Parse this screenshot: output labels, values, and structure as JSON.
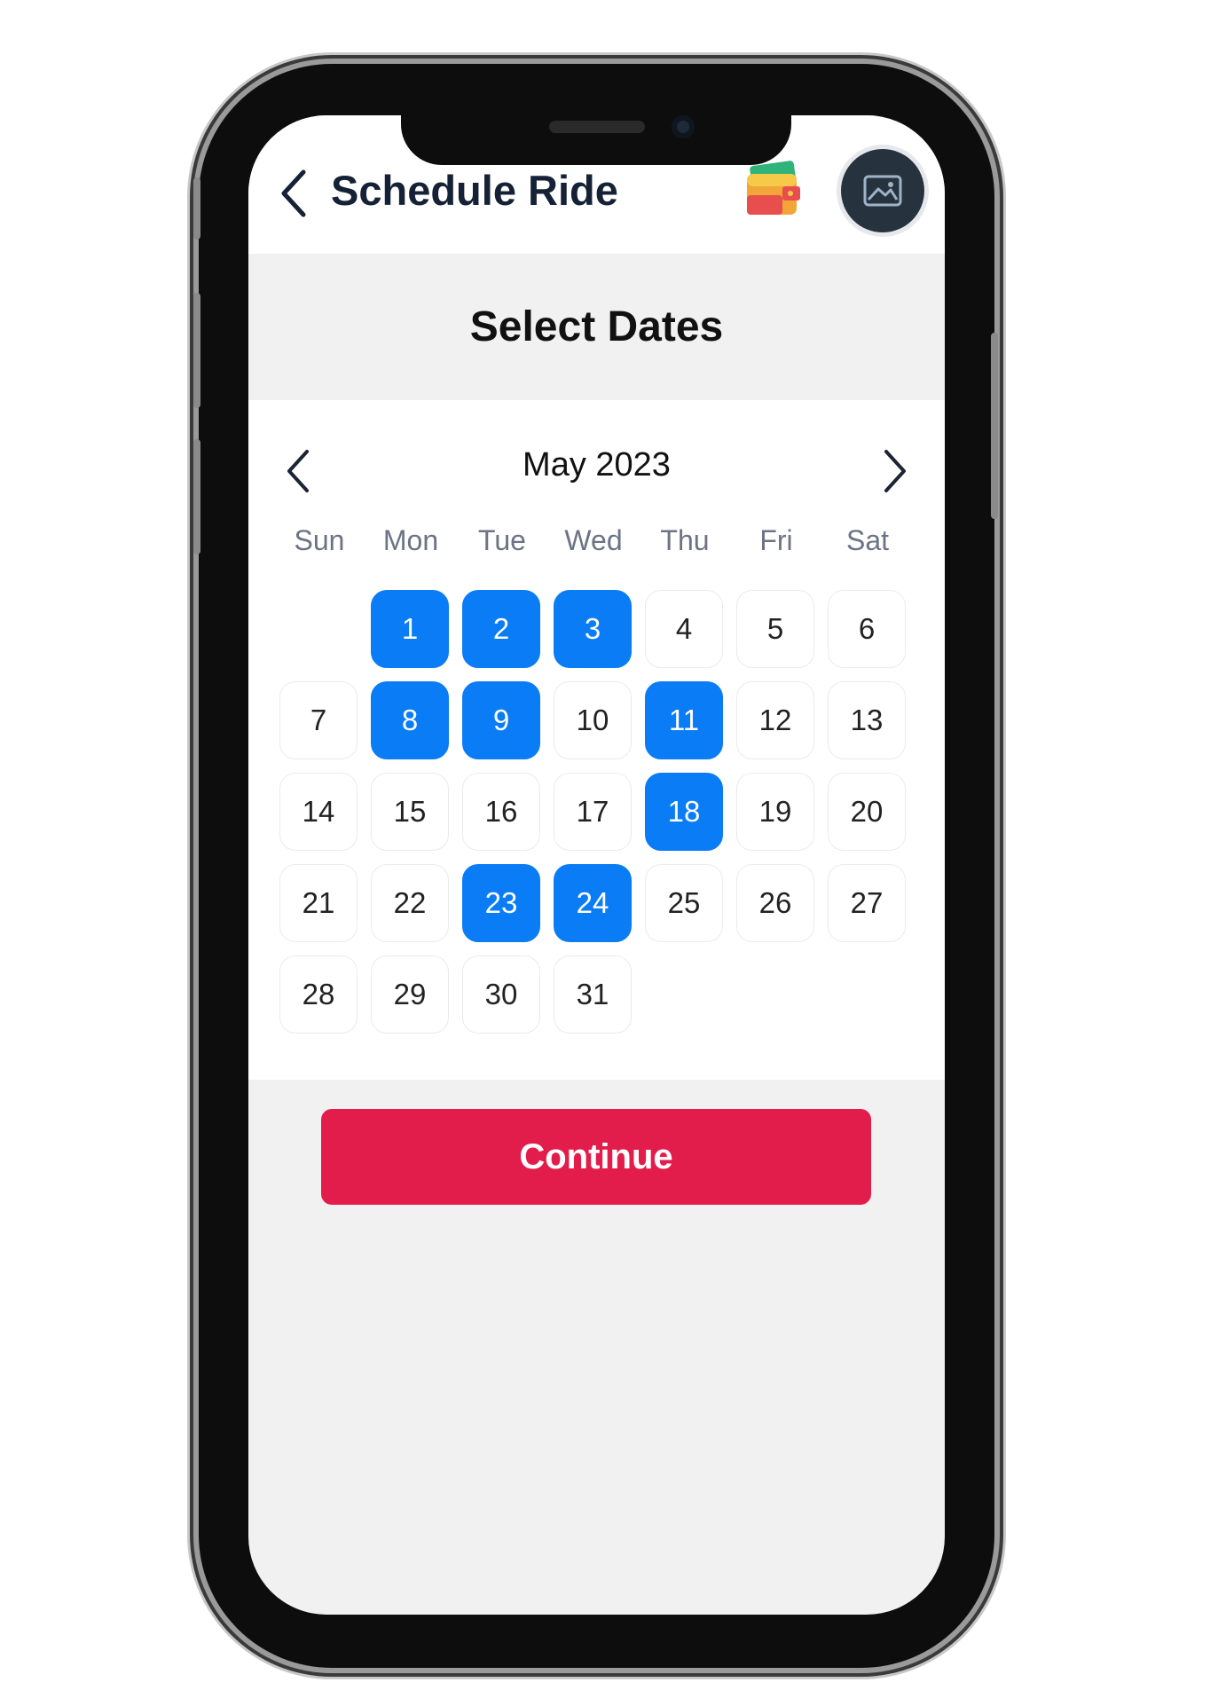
{
  "header": {
    "title": "Schedule Ride",
    "back_icon": "chevron-left-icon",
    "wallet_icon": "wallet-icon",
    "avatar_icon": "image-placeholder-icon"
  },
  "page": {
    "heading": "Select Dates"
  },
  "calendar": {
    "month_label": "May 2023",
    "prev_icon": "chevron-left-icon",
    "next_icon": "chevron-right-icon",
    "weekdays": [
      "Sun",
      "Mon",
      "Tue",
      "Wed",
      "Thu",
      "Fri",
      "Sat"
    ],
    "first_weekday_index": 1,
    "days": [
      "1",
      "2",
      "3",
      "4",
      "5",
      "6",
      "7",
      "8",
      "9",
      "10",
      "11",
      "12",
      "13",
      "14",
      "15",
      "16",
      "17",
      "18",
      "19",
      "20",
      "21",
      "22",
      "23",
      "24",
      "25",
      "26",
      "27",
      "28",
      "29",
      "30",
      "31"
    ],
    "selected_days": [
      1,
      2,
      3,
      8,
      9,
      11,
      18,
      23,
      24
    ]
  },
  "actions": {
    "continue_label": "Continue"
  },
  "colors": {
    "selected": "#0a7cf5",
    "primary_button": "#e31d4b",
    "title_text": "#152136",
    "weekday_text": "#6b7385"
  }
}
